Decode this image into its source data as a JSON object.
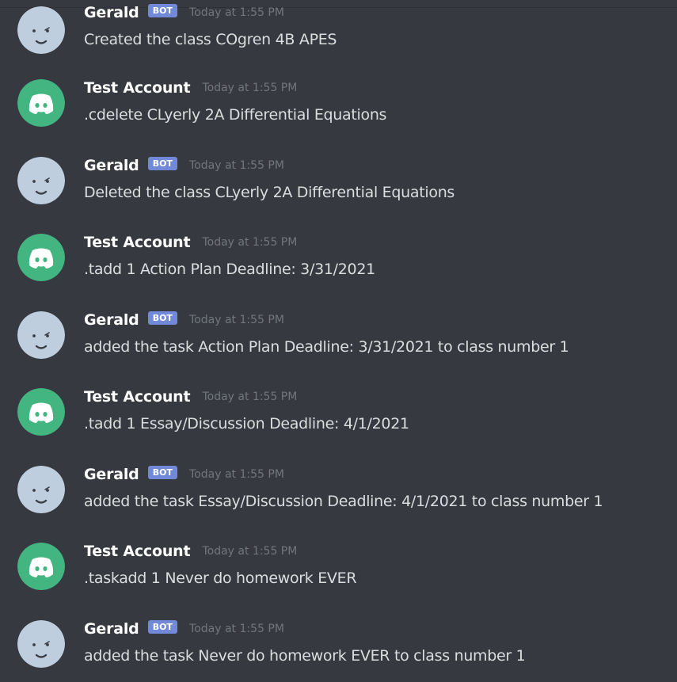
{
  "colors": {
    "background": "#36393f",
    "username": "#ffffff",
    "timestamp": "#72767d",
    "message_text": "#dcddde",
    "bot_tag": "#7289da",
    "discord_avatar_green": "#43b581",
    "bot_avatar_bg": "#bfcedf"
  },
  "messages": [
    {
      "author": "Gerald",
      "is_bot": true,
      "bot_tag": "BOT",
      "avatar": "bot-face-icon",
      "timestamp": "Today at 1:55 PM",
      "text": "Created the class COgren 4B APES"
    },
    {
      "author": "Test Account",
      "is_bot": false,
      "avatar": "discord-logo-icon",
      "timestamp": "Today at 1:55 PM",
      "text": ".cdelete CLyerly 2A Differential Equations"
    },
    {
      "author": "Gerald",
      "is_bot": true,
      "bot_tag": "BOT",
      "avatar": "bot-face-icon",
      "timestamp": "Today at 1:55 PM",
      "text": "Deleted the class CLyerly 2A Differential Equations"
    },
    {
      "author": "Test Account",
      "is_bot": false,
      "avatar": "discord-logo-icon",
      "timestamp": "Today at 1:55 PM",
      "text": ".tadd 1 Action Plan Deadline: 3/31/2021"
    },
    {
      "author": "Gerald",
      "is_bot": true,
      "bot_tag": "BOT",
      "avatar": "bot-face-icon",
      "timestamp": "Today at 1:55 PM",
      "text": "added the task Action Plan Deadline: 3/31/2021 to class number 1"
    },
    {
      "author": "Test Account",
      "is_bot": false,
      "avatar": "discord-logo-icon",
      "timestamp": "Today at 1:55 PM",
      "text": ".tadd 1 Essay/Discussion Deadline: 4/1/2021"
    },
    {
      "author": "Gerald",
      "is_bot": true,
      "bot_tag": "BOT",
      "avatar": "bot-face-icon",
      "timestamp": "Today at 1:55 PM",
      "text": "added the task Essay/Discussion Deadline: 4/1/2021 to class number 1"
    },
    {
      "author": "Test Account",
      "is_bot": false,
      "avatar": "discord-logo-icon",
      "timestamp": "Today at 1:55 PM",
      "text": ".taskadd 1 Never do homework EVER"
    },
    {
      "author": "Gerald",
      "is_bot": true,
      "bot_tag": "BOT",
      "avatar": "bot-face-icon",
      "timestamp": "Today at 1:55 PM",
      "text": "added the task Never do homework EVER to class number 1"
    }
  ]
}
